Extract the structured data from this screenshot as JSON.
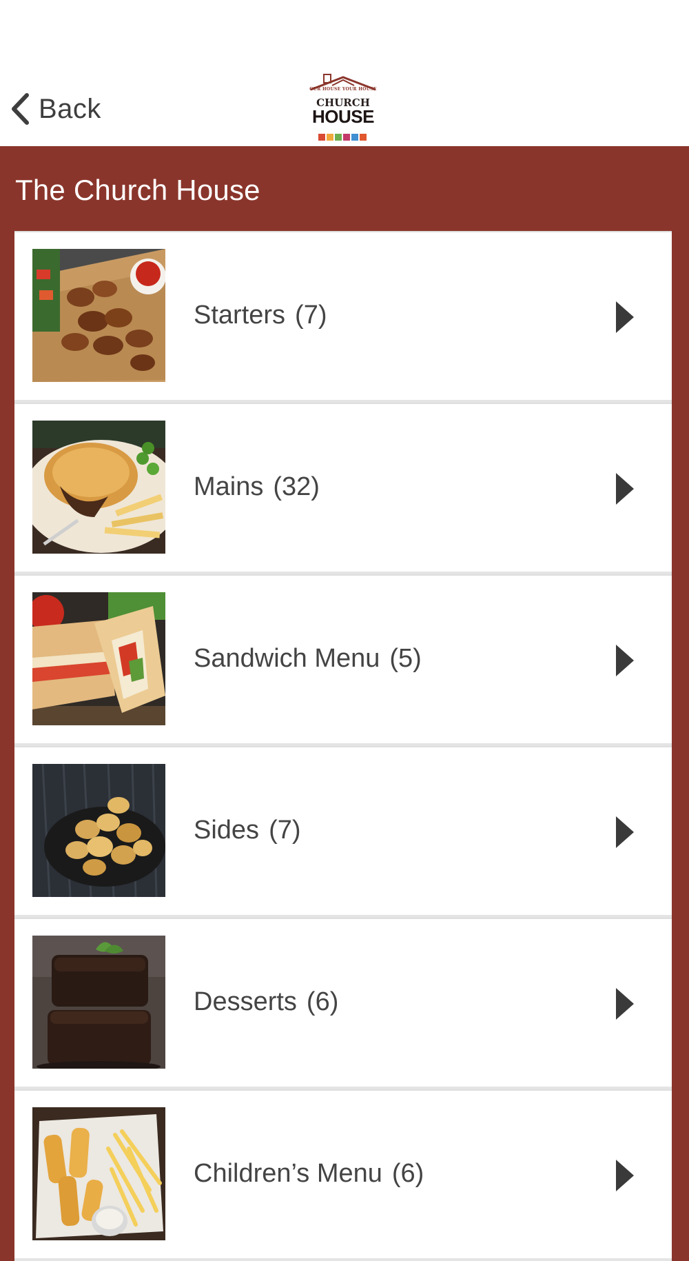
{
  "header": {
    "back_label": "Back",
    "logo": {
      "top_text": "OUR HOUSE YOUR HOUSE",
      "line1": "CHURCH",
      "line2": "HOUSE"
    }
  },
  "section": {
    "title": "The Church House"
  },
  "menu": {
    "items": [
      {
        "label": "Starters",
        "count": "(7)",
        "image": "chicken-wings-photo"
      },
      {
        "label": "Mains",
        "count": "(32)",
        "image": "pie-and-chips-photo"
      },
      {
        "label": "Sandwich Menu",
        "count": "(5)",
        "image": "panini-sandwich-photo"
      },
      {
        "label": "Sides",
        "count": "(7)",
        "image": "roast-potatoes-photo"
      },
      {
        "label": "Desserts",
        "count": "(6)",
        "image": "chocolate-brownie-photo"
      },
      {
        "label": "Children’s Menu",
        "count": "(6)",
        "image": "fish-fingers-chips-photo"
      }
    ]
  },
  "colors": {
    "brand": "#8a352b",
    "header_bg": "#ffffff",
    "text": "#444444",
    "arrow": "#3a3a3a"
  }
}
